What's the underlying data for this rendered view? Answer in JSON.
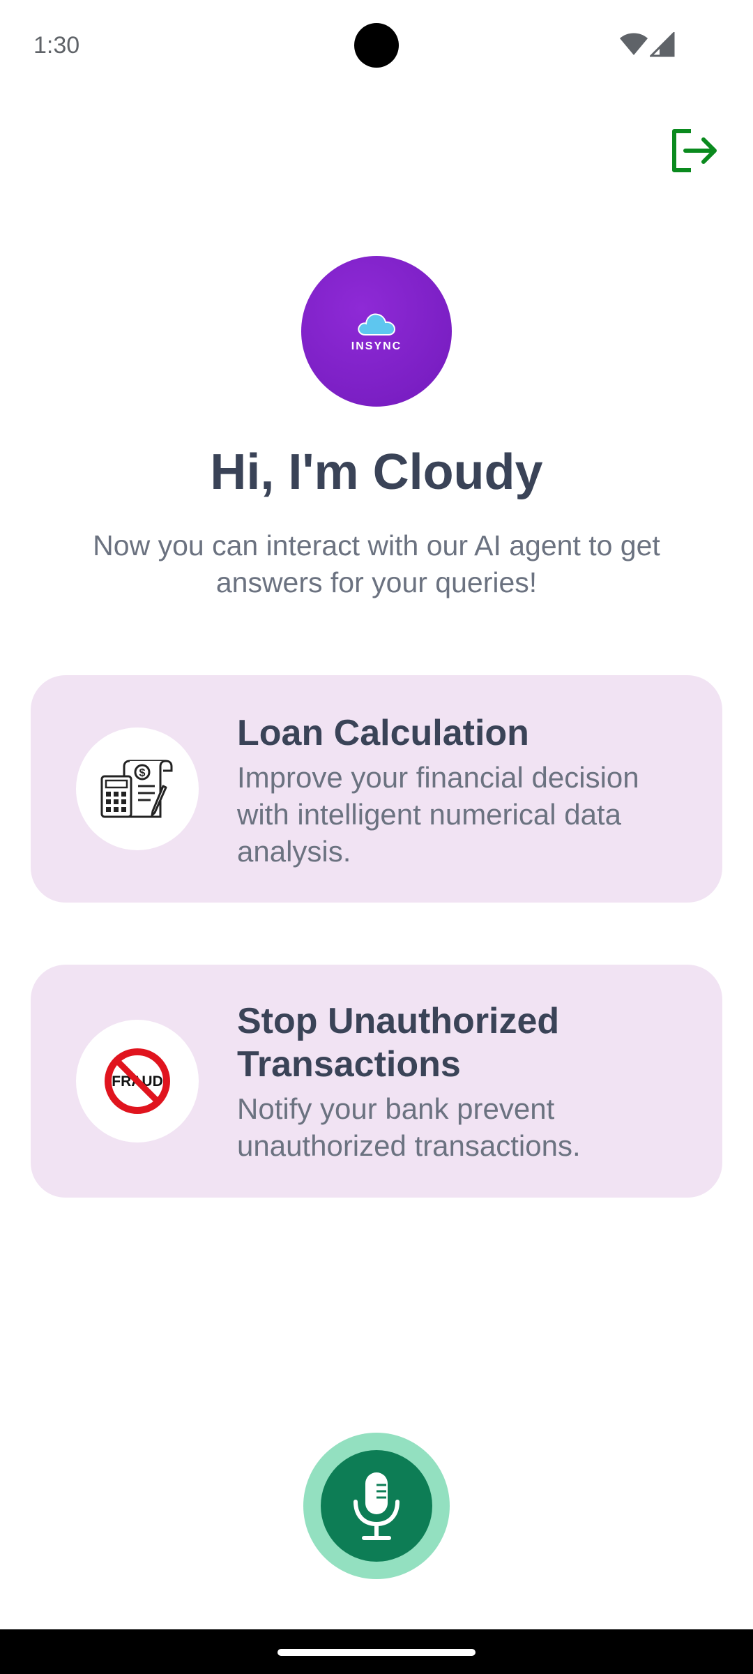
{
  "status_bar": {
    "time": "1:30"
  },
  "header": {
    "logout_icon": "logout-icon",
    "accent_color": "#0a8a1e"
  },
  "logo": {
    "text": "INSYNC",
    "background_color": "#7b1fc4"
  },
  "greeting": {
    "title": "Hi, I'm Cloudy",
    "subtitle": "Now you can interact with our AI agent to get answers for your queries!"
  },
  "cards": [
    {
      "title": "Loan Calculation",
      "description": "Improve your financial decision with intelligent numerical data analysis.",
      "icon": "loan-calculator-icon"
    },
    {
      "title": "Stop Unauthorized Transactions",
      "description": "Notify your bank prevent unauthorized transactions.",
      "icon": "fraud-icon",
      "icon_text": "FRAUD"
    }
  ],
  "mic": {
    "icon": "microphone-icon",
    "outer_color": "#93e0c0",
    "inner_color": "#0d7d55"
  },
  "colors": {
    "card_background": "#f1e3f3",
    "title_text": "#3a4357",
    "body_text": "#6b7280"
  }
}
